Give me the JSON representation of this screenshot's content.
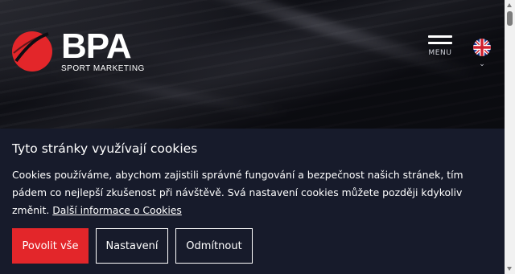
{
  "header": {
    "logo_word": "BPA",
    "logo_sub": "SPORT MARKETING",
    "menu_label": "MENU",
    "language_icon": "uk-flag-icon",
    "colors": {
      "brand_red": "#e3262a",
      "hero_bg": "#0d0e13"
    }
  },
  "cookie_banner": {
    "title": "Tyto stránky využívají cookies",
    "text": "Cookies používáme, abychom zajistili správné fungování a bezpečnost našich stránek, tím pádem co nejlepší zkušenost při návštěvě. Svá nastavení cookies můžete později kdykoliv změnit.",
    "link_text": "Další informace o Cookies",
    "buttons": {
      "accept_all": "Povolit vše",
      "settings": "Nastavení",
      "decline": "Odmítnout"
    },
    "colors": {
      "background": "#171b2b",
      "accept_button": "#e3262a"
    }
  }
}
